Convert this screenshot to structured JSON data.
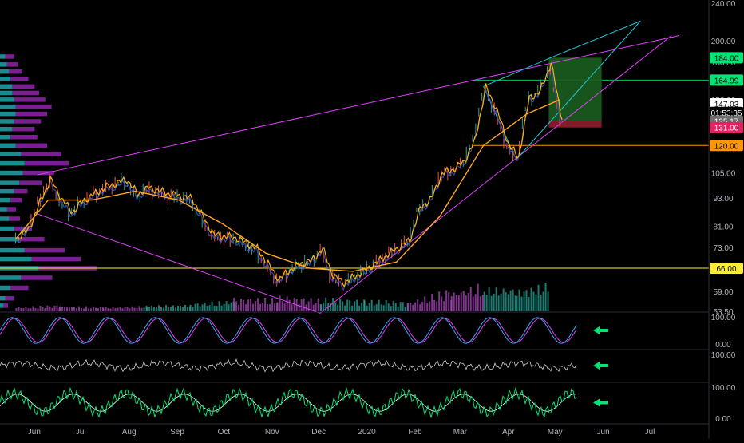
{
  "chart_data": {
    "type": "line",
    "symbol": "",
    "price_axis": {
      "ticks": [
        "240.00",
        "200.00",
        "180.00",
        "165.00",
        "150.00",
        "105.00",
        "93.00",
        "81.00",
        "73.00",
        "59.00",
        "53.50"
      ],
      "ylim": [
        53.5,
        240
      ],
      "scale": "log"
    },
    "price_labels": [
      {
        "text": "184.00",
        "value": 184,
        "color": "#00e676",
        "text_color": "#000000"
      },
      {
        "text": "164.99",
        "value": 164.99,
        "color": "#00e676",
        "text_color": "#000000"
      },
      {
        "text": "147.03",
        "value": 147.03,
        "color": "#ffffff",
        "text_color": "#000000"
      },
      {
        "text": "01:53:35",
        "value": 141,
        "color": "#000000",
        "text_color": "#ffffff"
      },
      {
        "text": "135.17",
        "value": 135.17,
        "color": "#6d6d6d",
        "text_color": "#ffffff"
      },
      {
        "text": "131.00",
        "value": 131,
        "color": "#e91e63",
        "text_color": "#ffffff"
      },
      {
        "text": "120.00",
        "value": 120,
        "color": "#ff9800",
        "text_color": "#000000"
      },
      {
        "text": "66.00",
        "value": 66,
        "color": "#ffeb3b",
        "text_color": "#000000"
      }
    ],
    "horizontal_lines": [
      {
        "value": 164.99,
        "color": "#00c853"
      },
      {
        "value": 120,
        "color": "#ff9800"
      },
      {
        "value": 66,
        "color": "#ffeb3b"
      }
    ],
    "time_axis": [
      "Jun",
      "Jul",
      "Aug",
      "Sep",
      "Oct",
      "Nov",
      "Dec",
      "2020",
      "Feb",
      "Mar",
      "Apr",
      "May",
      "Jun",
      "Jul"
    ],
    "price_series": [
      {
        "x": "2019-05-20",
        "y": 76
      },
      {
        "x": "2019-05-27",
        "y": 79
      },
      {
        "x": "2019-06-03",
        "y": 90
      },
      {
        "x": "2019-06-10",
        "y": 101
      },
      {
        "x": "2019-06-17",
        "y": 92
      },
      {
        "x": "2019-06-24",
        "y": 86
      },
      {
        "x": "2019-07-01",
        "y": 91
      },
      {
        "x": "2019-07-15",
        "y": 97
      },
      {
        "x": "2019-07-29",
        "y": 101
      },
      {
        "x": "2019-08-05",
        "y": 94
      },
      {
        "x": "2019-08-12",
        "y": 97
      },
      {
        "x": "2019-08-26",
        "y": 94
      },
      {
        "x": "2019-09-09",
        "y": 92
      },
      {
        "x": "2019-09-23",
        "y": 77
      },
      {
        "x": "2019-10-07",
        "y": 76
      },
      {
        "x": "2019-10-21",
        "y": 72
      },
      {
        "x": "2019-11-04",
        "y": 62
      },
      {
        "x": "2019-11-11",
        "y": 65
      },
      {
        "x": "2019-11-18",
        "y": 67
      },
      {
        "x": "2019-11-25",
        "y": 68
      },
      {
        "x": "2019-12-02",
        "y": 72
      },
      {
        "x": "2019-12-09",
        "y": 63
      },
      {
        "x": "2019-12-16",
        "y": 61
      },
      {
        "x": "2019-12-30",
        "y": 65
      },
      {
        "x": "2020-01-13",
        "y": 70
      },
      {
        "x": "2020-01-27",
        "y": 75
      },
      {
        "x": "2020-02-03",
        "y": 88
      },
      {
        "x": "2020-02-10",
        "y": 92
      },
      {
        "x": "2020-02-17",
        "y": 104
      },
      {
        "x": "2020-02-24",
        "y": 106
      },
      {
        "x": "2020-03-02",
        "y": 110
      },
      {
        "x": "2020-03-09",
        "y": 122
      },
      {
        "x": "2020-03-16",
        "y": 158
      },
      {
        "x": "2020-03-23",
        "y": 142
      },
      {
        "x": "2020-03-30",
        "y": 121
      },
      {
        "x": "2020-04-06",
        "y": 112
      },
      {
        "x": "2020-04-13",
        "y": 150
      },
      {
        "x": "2020-04-20",
        "y": 155
      },
      {
        "x": "2020-04-27",
        "y": 178
      },
      {
        "x": "2020-05-04",
        "y": 135
      }
    ],
    "ema_series": [
      {
        "x": "2019-05-20",
        "y": 76
      },
      {
        "x": "2019-06-10",
        "y": 92
      },
      {
        "x": "2019-07-08",
        "y": 92
      },
      {
        "x": "2019-08-05",
        "y": 96
      },
      {
        "x": "2019-09-02",
        "y": 92
      },
      {
        "x": "2019-09-30",
        "y": 82
      },
      {
        "x": "2019-10-28",
        "y": 71
      },
      {
        "x": "2019-11-25",
        "y": 66
      },
      {
        "x": "2019-12-23",
        "y": 65
      },
      {
        "x": "2020-01-20",
        "y": 68
      },
      {
        "x": "2020-02-17",
        "y": 85
      },
      {
        "x": "2020-03-16",
        "y": 120
      },
      {
        "x": "2020-04-13",
        "y": 140
      },
      {
        "x": "2020-05-04",
        "y": 150
      }
    ],
    "trendlines": [
      {
        "from": {
          "x": "2019-06-03",
          "y": 104
        },
        "to": {
          "x": "2020-07-20",
          "y": 205
        },
        "color": "#e040fb"
      },
      {
        "from": {
          "x": "2019-06-03",
          "y": 86
        },
        "to": {
          "x": "2019-12-02",
          "y": 53
        },
        "color": "#e040fb"
      },
      {
        "from": {
          "x": "2019-12-02",
          "y": 53
        },
        "to": {
          "x": "2020-07-15",
          "y": 205
        },
        "color": "#e040fb"
      },
      {
        "from": {
          "x": "2020-03-16",
          "y": 160
        },
        "to": {
          "x": "2020-04-30",
          "y": 185
        },
        "color": "#26c6da"
      },
      {
        "from": {
          "x": "2020-04-30",
          "y": 185
        },
        "to": {
          "x": "2020-06-25",
          "y": 220
        },
        "color": "#26c6da"
      },
      {
        "from": {
          "x": "2020-06-25",
          "y": 220
        },
        "to": {
          "x": "2020-04-06",
          "y": 112
        },
        "color": "#26c6da"
      },
      {
        "from": {
          "x": "2020-03-16",
          "y": 160
        },
        "to": {
          "x": "2020-04-06",
          "y": 112
        },
        "color": "#26c6da"
      }
    ],
    "long_position": {
      "from": "2020-04-27",
      "to": "2020-05-31",
      "entry": 135.17,
      "target": 184,
      "stop": 131
    },
    "volume_profile_rows": [
      {
        "price": 185,
        "a": 3,
        "b": 4
      },
      {
        "price": 178,
        "a": 4,
        "b": 5
      },
      {
        "price": 172,
        "a": 5,
        "b": 6
      },
      {
        "price": 166,
        "a": 6,
        "b": 8
      },
      {
        "price": 160,
        "a": 7,
        "b": 10
      },
      {
        "price": 155,
        "a": 7,
        "b": 12
      },
      {
        "price": 150,
        "a": 8,
        "b": 14
      },
      {
        "price": 145,
        "a": 9,
        "b": 16
      },
      {
        "price": 140,
        "a": 9,
        "b": 14
      },
      {
        "price": 135,
        "a": 8,
        "b": 12
      },
      {
        "price": 130,
        "a": 7,
        "b": 10
      },
      {
        "price": 125,
        "a": 6,
        "b": 12
      },
      {
        "price": 120,
        "a": 9,
        "b": 14
      },
      {
        "price": 115,
        "a": 12,
        "b": 18
      },
      {
        "price": 110,
        "a": 14,
        "b": 20
      },
      {
        "price": 105,
        "a": 13,
        "b": 14
      },
      {
        "price": 100,
        "a": 11,
        "b": 10
      },
      {
        "price": 96,
        "a": 8,
        "b": 6
      },
      {
        "price": 92,
        "a": 6,
        "b": 5
      },
      {
        "price": 88,
        "a": 4,
        "b": 4
      },
      {
        "price": 84,
        "a": 5,
        "b": 5
      },
      {
        "price": 80,
        "a": 8,
        "b": 8
      },
      {
        "price": 76,
        "a": 10,
        "b": 12
      },
      {
        "price": 72,
        "a": 14,
        "b": 18
      },
      {
        "price": 69,
        "a": 18,
        "b": 22
      },
      {
        "price": 66,
        "a": 22,
        "b": 26
      },
      {
        "price": 63,
        "a": 12,
        "b": 14
      },
      {
        "price": 60,
        "a": 6,
        "b": 8
      },
      {
        "price": 57,
        "a": 3,
        "b": 4
      },
      {
        "price": 55,
        "a": 2,
        "b": 2
      }
    ],
    "volume": [
      {
        "x": "2019-05-20",
        "v": 0.3
      },
      {
        "x": "2019-06-17",
        "v": 0.4
      },
      {
        "x": "2019-07-15",
        "v": 0.3
      },
      {
        "x": "2019-08-12",
        "v": 0.4
      },
      {
        "x": "2019-09-09",
        "v": 0.5
      },
      {
        "x": "2019-10-07",
        "v": 0.8
      },
      {
        "x": "2019-11-04",
        "v": 0.9
      },
      {
        "x": "2019-12-02",
        "v": 0.8
      },
      {
        "x": "2019-12-30",
        "v": 0.7
      },
      {
        "x": "2020-01-27",
        "v": 0.6
      },
      {
        "x": "2020-02-24",
        "v": 1.4
      },
      {
        "x": "2020-03-16",
        "v": 1.8
      },
      {
        "x": "2020-04-06",
        "v": 1.6
      },
      {
        "x": "2020-04-27",
        "v": 2.1
      }
    ],
    "oscillators": [
      {
        "ticks": [
          "100.00",
          "0.00"
        ],
        "range": [
          0,
          100
        ]
      },
      {
        "ticks": [
          "100.00"
        ],
        "range": [
          0,
          100
        ]
      },
      {
        "ticks": [
          "100.00",
          "0.00"
        ],
        "range": [
          0,
          100
        ]
      }
    ],
    "arrow_color": "#00e676",
    "grid": false
  }
}
